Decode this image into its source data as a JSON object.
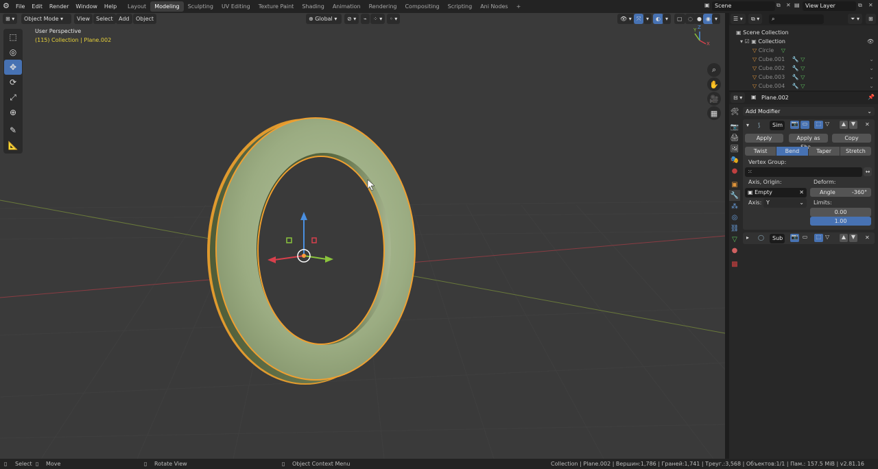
{
  "topbar": {
    "menus": [
      "File",
      "Edit",
      "Render",
      "Window",
      "Help"
    ],
    "workspaces": [
      {
        "label": "Layout",
        "active": false
      },
      {
        "label": "Modeling",
        "active": true
      },
      {
        "label": "Sculpting",
        "active": false
      },
      {
        "label": "UV Editing",
        "active": false
      },
      {
        "label": "Texture Paint",
        "active": false
      },
      {
        "label": "Shading",
        "active": false
      },
      {
        "label": "Animation",
        "active": false
      },
      {
        "label": "Rendering",
        "active": false
      },
      {
        "label": "Compositing",
        "active": false
      },
      {
        "label": "Scripting",
        "active": false
      },
      {
        "label": "Ani Nodes",
        "active": false
      }
    ],
    "add_tab": "+",
    "scene": "Scene",
    "view_layer": "View Layer"
  },
  "viewport": {
    "mode": "Object Mode",
    "menus": [
      "View",
      "Select",
      "Add",
      "Object"
    ],
    "orientation": "Global",
    "perspective": "User Perspective",
    "context": "(115) Collection | Plane.002",
    "axis_labels": {
      "x": "X",
      "y": "Y",
      "z": "Z"
    }
  },
  "outliner": {
    "root": "Scene Collection",
    "collection": "Collection",
    "items": [
      "Circle",
      "Cube.001",
      "Cube.002",
      "Cube.003",
      "Cube.004"
    ]
  },
  "properties": {
    "object": "Plane.002",
    "add_modifier": "Add Modifier",
    "modifier1": {
      "name": "Sim",
      "apply": "Apply",
      "apply_shape": "Apply as Sha...",
      "copy": "Copy",
      "modes": [
        {
          "label": "Twist",
          "active": false
        },
        {
          "label": "Bend",
          "active": true
        },
        {
          "label": "Taper",
          "active": false
        },
        {
          "label": "Stretch",
          "active": false
        }
      ],
      "vertex_group_label": "Vertex Group:",
      "axis_origin_label": "Axis, Origin:",
      "origin_value": "Empty",
      "deform_label": "Deform:",
      "angle_label": "Angle",
      "angle_value": "-360°",
      "axis_label": "Axis:",
      "axis_value": "Y",
      "limits_label": "Limits:",
      "limit_low": "0.00",
      "limit_high": "1.00"
    },
    "modifier2": {
      "name": "Sub"
    }
  },
  "statusbar": {
    "select": "Select",
    "move": "Move",
    "rotate": "Rotate View",
    "context_menu": "Object Context Menu",
    "stats": "Collection | Plane.002 | Вершин:1,786 | Граней:1,741 | Треуг.:3,568 | Объектов:1/1 | Пам.: 157.5 MiB | v2.81.16"
  },
  "colors": {
    "accent": "#4772b3",
    "selection_outline": "#f0a030",
    "context_text": "#e8d23a",
    "ring": "#93a77a"
  }
}
